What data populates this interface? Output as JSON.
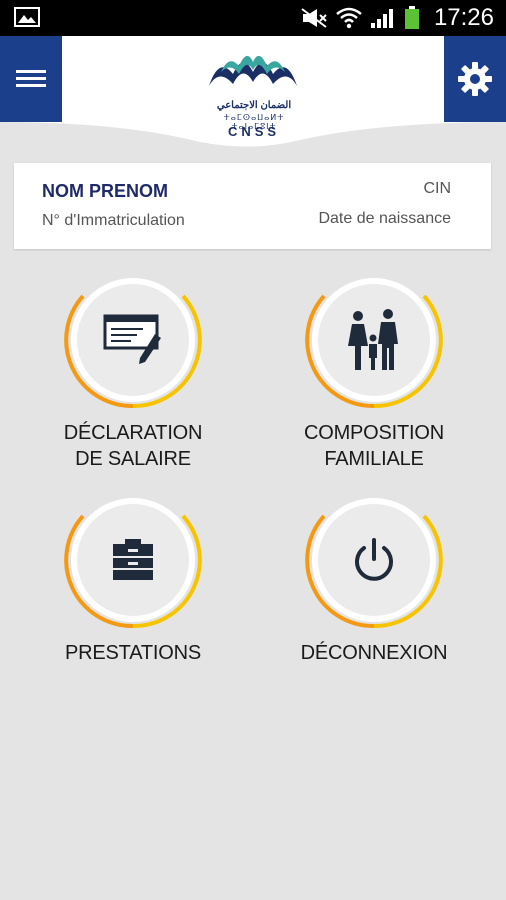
{
  "status_bar": {
    "time": "17:26"
  },
  "header": {
    "logo_arabic": "الضمان الاجتماعي",
    "logo_tifinagh": "ⵜⴰⵎⵙⴰⵡⴰⵍⵜ ⵜⴰⵏⴰⵎⵓⵏⵜ",
    "logo_text": "CNSS"
  },
  "profile": {
    "name": "NOM PRENOM",
    "cin_label": "CIN",
    "immatriculation_label": "N° d'Immatriculation",
    "birthdate_label": "Date de naissance"
  },
  "tiles": [
    {
      "line1": "DÉCLARATION",
      "line2": "DE SALAIRE",
      "icon": "salary-declaration-icon"
    },
    {
      "line1": "COMPOSITION",
      "line2": "FAMILIALE",
      "icon": "family-icon"
    },
    {
      "line1": "PRESTATIONS",
      "line2": "",
      "icon": "briefcase-icon"
    },
    {
      "line1": "DÉCONNEXION",
      "line2": "",
      "icon": "power-icon"
    }
  ],
  "colors": {
    "brand_blue": "#1b3f8b",
    "navy_text": "#1f2a6a",
    "ring_orange": "#f39a12",
    "ring_yellow": "#f6c400",
    "logo_teal": "#3aa6a0",
    "logo_dark": "#1b2f66"
  }
}
